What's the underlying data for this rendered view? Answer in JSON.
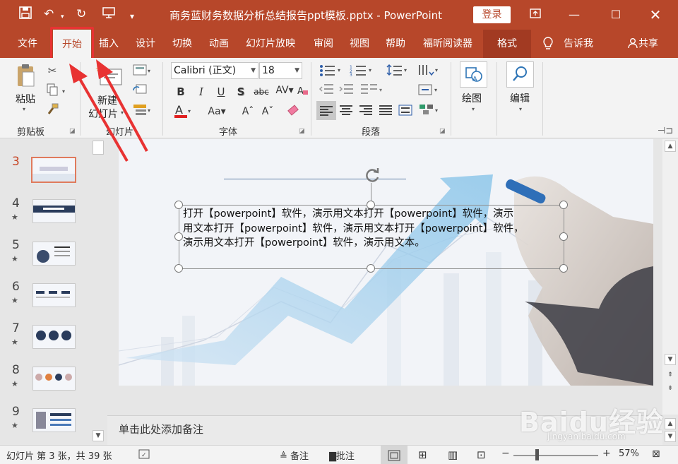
{
  "titlebar": {
    "title": "商务蓝财务数据分析总结报告ppt模板.pptx - PowerPoint",
    "login_label": "登录",
    "qat_icons": [
      "save-icon",
      "undo-icon",
      "redo-icon",
      "present-icon",
      "customize-icon"
    ]
  },
  "tabs": {
    "file": "文件",
    "home": "开始",
    "insert": "插入",
    "design": "设计",
    "transitions": "切换",
    "animations": "动画",
    "slideshow": "幻灯片放映",
    "review": "审阅",
    "view": "视图",
    "help": "帮助",
    "reader": "福昕阅读器",
    "format": "格式",
    "tellme": "告诉我",
    "share": "共享"
  },
  "ribbon": {
    "paste": "粘贴",
    "clipboard": "剪贴板",
    "new_slide_line1": "新建",
    "new_slide_line2": "幻灯片",
    "slides": "幻灯片",
    "font_name": "Calibri (正文)",
    "font_size": "18",
    "font": "字体",
    "paragraph": "段落",
    "drawing": "绘图",
    "editing": "编辑"
  },
  "thumbnails": [
    {
      "number": "3",
      "star": ""
    },
    {
      "number": "4",
      "star": "★"
    },
    {
      "number": "5",
      "star": "★"
    },
    {
      "number": "6",
      "star": "★"
    },
    {
      "number": "7",
      "star": "★"
    },
    {
      "number": "8",
      "star": "★"
    },
    {
      "number": "9",
      "star": "★"
    }
  ],
  "slide": {
    "text_line1": "打开【powerpoint】软件，演示用文本打开【powerpoint】软件，演示",
    "text_line2": "用文本打开【powerpoint】软件，演示用文本打开【powerpoint】软件，",
    "text_line3": "演示用文本打开【powerpoint】软件，演示用文本。"
  },
  "notes": {
    "placeholder": "单击此处添加备注"
  },
  "status": {
    "slide_info": "幻灯片 第 3 张，共 39 张",
    "notes": "备注",
    "comments": "批注",
    "zoom": "57%"
  },
  "watermark": {
    "text": "Baidu经验",
    "url": "jingyan.baidu.com"
  },
  "colors": {
    "accent": "#b7472a",
    "highlight": "#e83232"
  }
}
